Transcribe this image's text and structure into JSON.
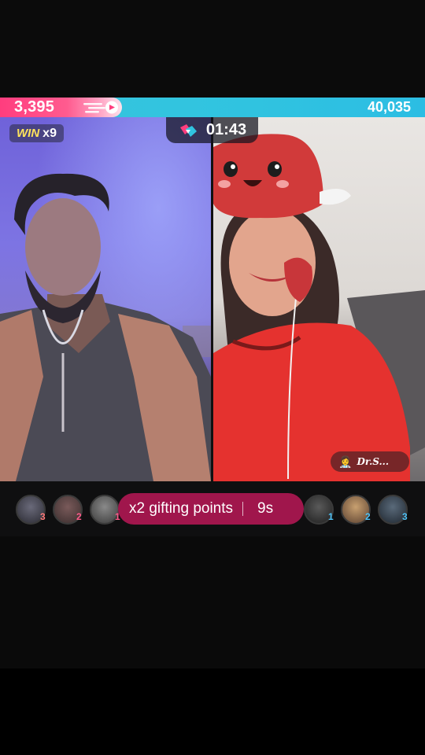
{
  "battle": {
    "left_score": "3,395",
    "right_score": "40,035",
    "win_label": "WIN",
    "win_count": "x9",
    "timer": "01:43"
  },
  "right_host": {
    "emoji": "👩‍⚕️",
    "name": "Dr.S..."
  },
  "gift_banner": {
    "text": "x2 gifting points",
    "countdown": "9s"
  },
  "left_gifters": [
    {
      "rank": "3",
      "rank_color": "#ff7a7a"
    },
    {
      "rank": "2",
      "rank_color": "#ff5a8a"
    },
    {
      "rank": "1",
      "rank_color": "#ff5a8a"
    }
  ],
  "right_gifters": [
    {
      "rank": "1",
      "rank_color": "#4fc3f7"
    },
    {
      "rank": "2",
      "rank_color": "#4fc3f7"
    },
    {
      "rank": "3",
      "rank_color": "#4fc3f7"
    }
  ],
  "colors": {
    "left_team": "#ff3d7e",
    "right_team": "#30c3e0",
    "gift_banner": "#a0164c",
    "win_label": "#ffe45c"
  }
}
